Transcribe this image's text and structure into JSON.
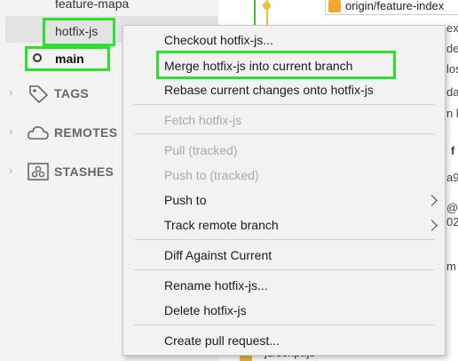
{
  "sidebar": {
    "branches": {
      "feature_mapa": "feature-mapa",
      "hotfix_js": "hotfix-js",
      "main": "main"
    },
    "sections": {
      "tags": "TAGS",
      "remotes": "REMOTES",
      "stashes": "STASHES"
    }
  },
  "graph": {
    "remote_ref": "origin/feature-index",
    "fragments": [
      "ex",
      "dex",
      "los",
      "dar",
      "n l",
      "f",
      "a9",
      "@g",
      "02",
      "m"
    ],
    "bottom_file": "js/script.js"
  },
  "context_menu": {
    "checkout": "Checkout hotfix-js...",
    "merge": "Merge hotfix-js into current branch",
    "rebase": "Rebase current changes onto hotfix-js",
    "fetch": "Fetch hotfix-js",
    "pull": "Pull  (tracked)",
    "push_tracked": "Push to  (tracked)",
    "push_to": "Push to",
    "track_remote": "Track remote branch",
    "diff": "Diff Against Current",
    "rename": "Rename hotfix-js...",
    "delete": "Delete hotfix-js",
    "create_pr": "Create pull request..."
  },
  "colors": {
    "highlight": "#2ee02e",
    "graph_line_green": "#56b04a",
    "graph_line_yellow": "#e8c23a",
    "git_icon": "#f0a830"
  }
}
